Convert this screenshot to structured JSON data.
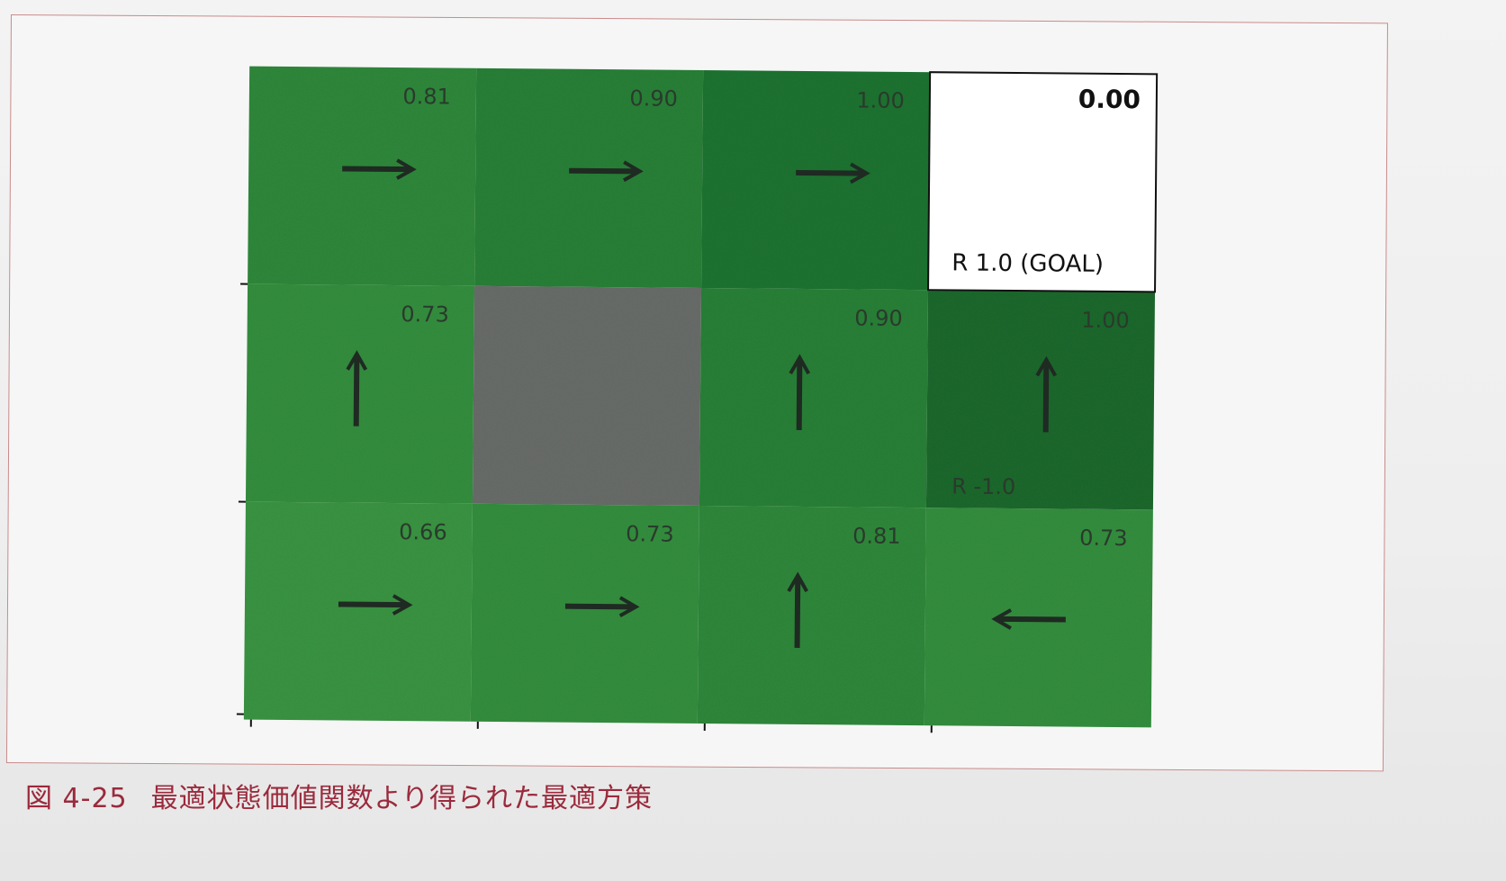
{
  "figure": {
    "caption_number": "図 4-25",
    "caption_text": "最適状態価値関数より得られた最適方策"
  },
  "grid": {
    "rows": 3,
    "cols": 4,
    "cells": [
      {
        "row": 0,
        "col": 0,
        "value": "0.81",
        "arrow": "right",
        "fill": "#2f8a3c"
      },
      {
        "row": 0,
        "col": 1,
        "value": "0.90",
        "arrow": "right",
        "fill": "#2a8238"
      },
      {
        "row": 0,
        "col": 2,
        "value": "1.00",
        "arrow": "right",
        "fill": "#207532"
      },
      {
        "row": 0,
        "col": 3,
        "value": "0.00",
        "arrow": "",
        "fill": "#ffffff",
        "reward_label": "R 1.0 (GOAL)",
        "goal": true
      },
      {
        "row": 1,
        "col": 0,
        "value": "0.73",
        "arrow": "up",
        "fill": "#35903f"
      },
      {
        "row": 1,
        "col": 1,
        "value": "",
        "arrow": "",
        "fill": "#6a6e6b",
        "wall": true
      },
      {
        "row": 1,
        "col": 2,
        "value": "0.90",
        "arrow": "up",
        "fill": "#2a8238"
      },
      {
        "row": 1,
        "col": 3,
        "value": "1.00",
        "arrow": "up",
        "fill": "#1b6a2e",
        "reward_label": "R -1.0"
      },
      {
        "row": 2,
        "col": 0,
        "value": "0.66",
        "arrow": "right",
        "fill": "#3a9643"
      },
      {
        "row": 2,
        "col": 1,
        "value": "0.73",
        "arrow": "right",
        "fill": "#35903f"
      },
      {
        "row": 2,
        "col": 2,
        "value": "0.81",
        "arrow": "up",
        "fill": "#2f8a3c"
      },
      {
        "row": 2,
        "col": 3,
        "value": "0.73",
        "arrow": "left",
        "fill": "#35903f"
      }
    ]
  },
  "colors": {
    "arrow": "#1f2a22",
    "value_text": "#2a3a2c",
    "goal_text": "#111111",
    "caption": "#9b2a3c"
  }
}
